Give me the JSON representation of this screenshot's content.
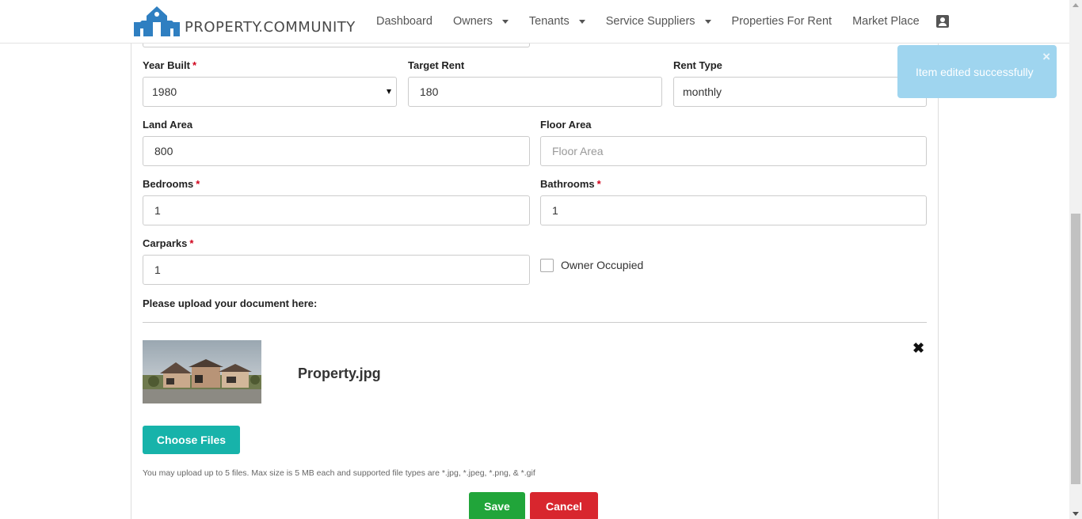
{
  "brand": {
    "name": "PROPERTY.COMMUNITY",
    "logo_icon": "house-logo-icon",
    "color": "#2f7fc1"
  },
  "nav": {
    "items": [
      {
        "label": "Dashboard",
        "has_dropdown": false
      },
      {
        "label": "Owners",
        "has_dropdown": true
      },
      {
        "label": "Tenants",
        "has_dropdown": true
      },
      {
        "label": "Service Suppliers",
        "has_dropdown": true
      },
      {
        "label": "Properties For Rent",
        "has_dropdown": false
      },
      {
        "label": "Market Place",
        "has_dropdown": false
      }
    ],
    "user_icon": "contact-card-icon"
  },
  "form": {
    "year_built": {
      "label": "Year Built",
      "required_mark": "*",
      "value": "1980"
    },
    "target_rent": {
      "label": "Target Rent",
      "value": "180"
    },
    "rent_type": {
      "label": "Rent Type",
      "value": "monthly"
    },
    "land_area": {
      "label": "Land Area",
      "value": "800"
    },
    "floor_area": {
      "label": "Floor Area",
      "placeholder": "Floor Area",
      "value": ""
    },
    "bedrooms": {
      "label": "Bedrooms",
      "required_mark": "*",
      "value": "1"
    },
    "bathrooms": {
      "label": "Bathrooms",
      "required_mark": "*",
      "value": "1"
    },
    "carparks": {
      "label": "Carparks",
      "required_mark": "*",
      "value": "1"
    },
    "owner_occupied": {
      "label": "Owner Occupied",
      "checked": false
    }
  },
  "upload": {
    "title": "Please upload your document here:",
    "files": [
      {
        "name": "Property.jpg",
        "remove_icon": "close-icon"
      }
    ],
    "choose_label": "Choose Files",
    "help_text": "You may upload up to 5 files. Max size is 5 MB each and supported file types are *.jpg, *.jpeg, *.png, & *.gif"
  },
  "actions": {
    "save_label": "Save",
    "cancel_label": "Cancel"
  },
  "toast": {
    "message": "Item edited successfully",
    "close_glyph": "×"
  },
  "colors": {
    "teal": "#17b3aa",
    "save": "#21a53a",
    "cancel": "#d8262e",
    "toast": "#9fd5ef",
    "required": "#d0021b"
  }
}
